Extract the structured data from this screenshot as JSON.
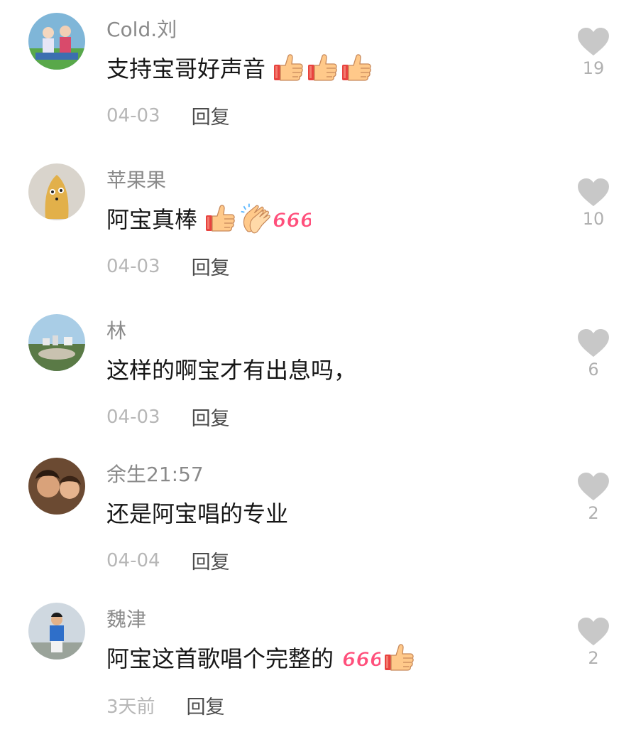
{
  "comments": [
    {
      "username": "Cold.刘",
      "text": "支持宝哥好声音",
      "emojis": [
        "thumbs-up-icon",
        "thumbs-up-icon",
        "thumbs-up-icon"
      ],
      "date": "04-03",
      "reply_label": "回复",
      "likes": "19"
    },
    {
      "username": "苹果果",
      "text": "阿宝真棒",
      "emojis": [
        "thumbs-up-icon",
        "clapping-hands-icon",
        "666-icon"
      ],
      "date": "04-03",
      "reply_label": "回复",
      "likes": "10"
    },
    {
      "username": "林",
      "text": "这样的啊宝才有出息吗，",
      "emojis": [],
      "date": "04-03",
      "reply_label": "回复",
      "likes": "6"
    },
    {
      "username": "余生21:57",
      "text": "还是阿宝唱的专业",
      "emojis": [],
      "date": "04-04",
      "reply_label": "回复",
      "likes": "2"
    },
    {
      "username": "魏津",
      "text": "阿宝这首歌唱个完整的",
      "emojis": [
        "666-icon",
        "thumbs-up-icon"
      ],
      "date": "3天前",
      "reply_label": "回复",
      "likes": "2"
    }
  ],
  "colors": {
    "username": "#8a8a8a",
    "text": "#161616",
    "date": "#b7b7b7",
    "reply": "#4b4b4b",
    "heart": "#c8c8c8",
    "emoji_666": "#ff4f7b",
    "thumb_skin": "#ffc98a",
    "thumb_cuff": "#e8433f"
  }
}
